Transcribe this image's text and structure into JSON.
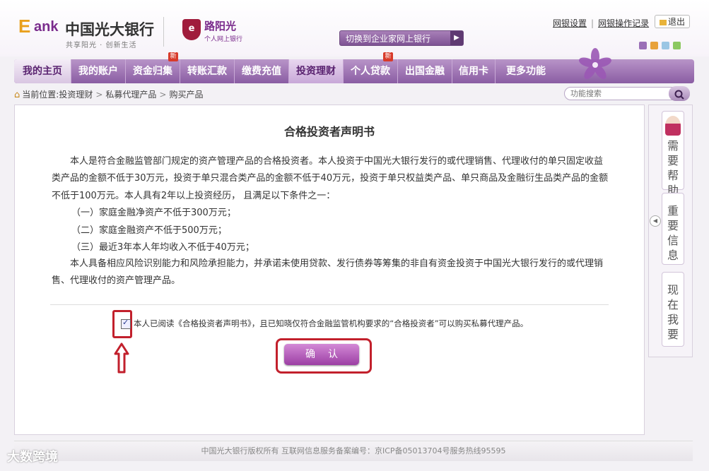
{
  "header": {
    "logo_e": "E",
    "logo_bank": "ank",
    "logo_cn": "中国光大银行",
    "slogan": "共享阳光 · 创新生活",
    "brand_badge": "e",
    "brand_name": "路阳光",
    "brand_sub": "个人网上银行",
    "switch_label": "切换到企业家网上银行",
    "links": [
      "网银设置",
      "网银操作记录"
    ],
    "logout": "退出",
    "skin_colors": [
      "#9a6fb7",
      "#e8a23a",
      "#9bc6e4",
      "#8cc860"
    ]
  },
  "nav": {
    "items": [
      {
        "label": "我的主页"
      },
      {
        "label": "我的账户"
      },
      {
        "label": "资金归集",
        "badge": "新"
      },
      {
        "label": "转账汇款"
      },
      {
        "label": "缴费充值"
      },
      {
        "label": "投资理财"
      },
      {
        "label": "个人贷款",
        "badge": "新"
      },
      {
        "label": "出国金融"
      },
      {
        "label": "信用卡"
      },
      {
        "label": "更多功能"
      }
    ]
  },
  "breadcrumb": {
    "prefix": "当前位置:",
    "items": [
      "投资理财",
      "私募代理产品",
      "购买产品"
    ]
  },
  "search": {
    "placeholder": "功能搜索"
  },
  "document": {
    "title": "合格投资者声明书",
    "para1": "本人是符合金融监管部门规定的资产管理产品的合格投资者。本人投资于中国光大银行发行的或代理销售、代理收付的单只固定收益类产品的金额不低于30万元，投资于单只混合类产品的金额不低于40万元，投资于单只权益类产品、单只商品及金融衍生品类产品的金额不低于100万元。本人具有2年以上投资经历， 且满足以下条件之一：",
    "conditions": [
      "（一）家庭金融净资产不低于300万元；",
      "（二）家庭金融资产不低于500万元；",
      "（三）最近3年本人年均收入不低于40万元；"
    ],
    "para2": "本人具备相应风险识别能力和风险承担能力，并承诺未使用贷款、发行债券等筹集的非自有资金投资于中国光大银行发行的或代理销售、代理收付的资产管理产品。",
    "agree_text": "本人已阅读《合格投资者声明书》，且已知晓仅符合金融监管机构要求的“合格投资者”可以购买私募代理产品。",
    "agree_checked": true,
    "confirm_label": "确认"
  },
  "side": {
    "items": [
      "需要帮助",
      "重要信息",
      "现在我要"
    ]
  },
  "footer": {
    "text": "中国光大银行版权所有  互联网信息服务备案编号：京ICP备05013704号服务热线95595"
  },
  "watermark": "大数跨境"
}
